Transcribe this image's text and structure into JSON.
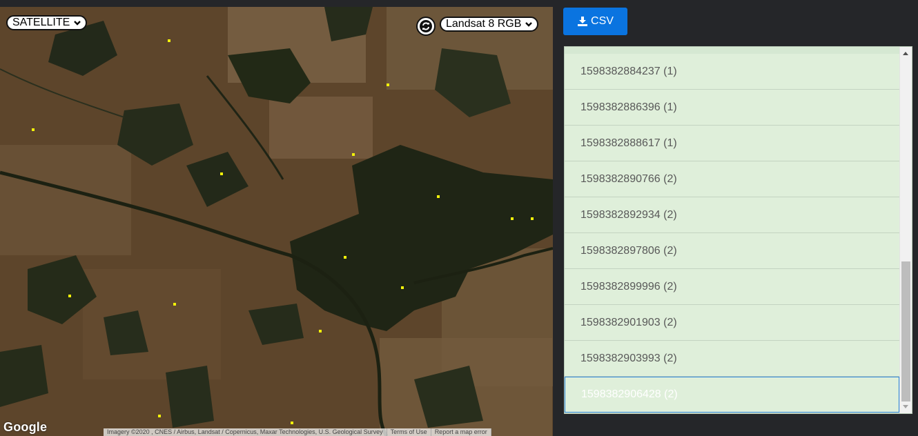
{
  "map": {
    "basemap_select": {
      "value": "SATELLITE"
    },
    "layer_select": {
      "value": "Landsat 8 RGB"
    },
    "logo": "Google",
    "attribution": {
      "imagery": "Imagery ©2020 , CNES / Airbus, Landsat / Copernicus, Maxar Technologies, U.S. Geological Survey",
      "terms": "Terms of Use",
      "report": "Report a map error"
    },
    "point_color": "#f2f20a"
  },
  "toolbar": {
    "csv_label": "CSV",
    "csv_icon": "download-icon",
    "csv_color": "#0a74e0"
  },
  "list": {
    "items": [
      {
        "label": "1598382884237 (1)"
      },
      {
        "label": "1598382886396 (1)"
      },
      {
        "label": "1598382888617 (1)"
      },
      {
        "label": "1598382890766 (2)"
      },
      {
        "label": "1598382892934 (2)"
      },
      {
        "label": "1598382897806 (2)"
      },
      {
        "label": "1598382899996 (2)"
      },
      {
        "label": "1598382901903 (2)"
      },
      {
        "label": "1598382903993 (2)"
      },
      {
        "label": "1598382906428 (2)"
      }
    ],
    "selected_index": 9
  }
}
